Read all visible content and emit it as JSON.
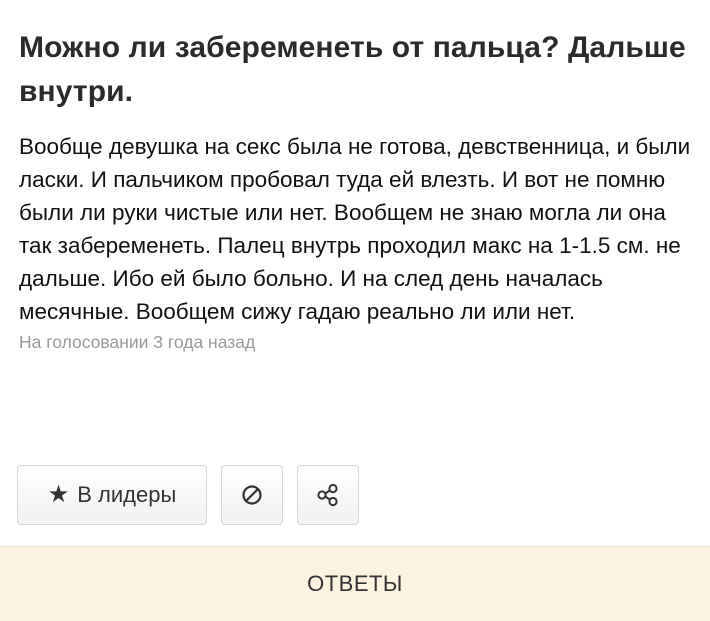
{
  "question": {
    "title": "Можно ли забеременеть от пальца? Дальше внутри.",
    "body": "Вообще девушка на секс была не готова, девственница, и были ласки. И пальчиком пробовал туда ей влезть. И вот не помню были ли руки чистые или нет. Вообщем не знаю могла ли она так забеременеть. Палец внутрь проходил макс на 1-1.5 см. не дальше. Ибо ей было больно. И на след день началась месячные. Вообщем сижу гадаю реально ли или нет.",
    "meta": "На голосовании 3 года назад"
  },
  "actions": {
    "leaders_label": "В лидеры",
    "leaders_icon": "star-icon",
    "block_icon": "block-icon",
    "share_icon": "share-icon"
  },
  "answers_bar": {
    "label": "ОТВЕТЫ"
  },
  "colors": {
    "answers_bar_background": "#fbf3df",
    "meta_text": "#9a9a9a"
  }
}
